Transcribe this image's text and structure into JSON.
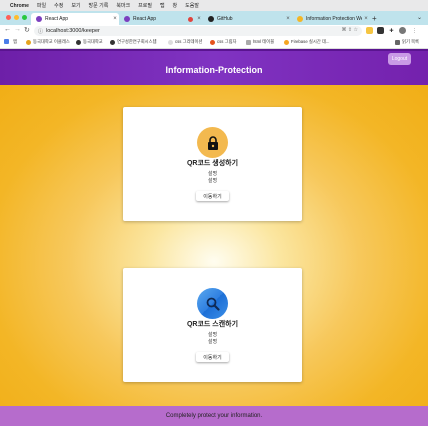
{
  "menubar": {
    "app": "Chrome",
    "items": [
      "파일",
      "수정",
      "보기",
      "방문 기록",
      "북마크",
      "프로필",
      "탭",
      "창",
      "도움말"
    ]
  },
  "tabs": [
    {
      "title": "React App",
      "active": true
    },
    {
      "title": "React App",
      "active": false
    },
    {
      "title": "GitHub",
      "active": false
    },
    {
      "title": "Information Protection Web",
      "active": false
    }
  ],
  "toolbar": {
    "url": "localhost:3000/keeper"
  },
  "bookmarks": {
    "apps_label": "앱",
    "items": [
      "동국대학교 이클래스",
      "동국대학교",
      "연구성한연구회시스템",
      "css 그라데이션",
      "css 그림자",
      "html 테이블",
      "Firebase 실시간 데..."
    ],
    "reading_list": "읽기 목록"
  },
  "app": {
    "title": "Information-Protection",
    "logout_label": "Logout",
    "cards": [
      {
        "title": "QR코드 생성하기",
        "desc1": "설명",
        "desc2": "설명",
        "button": "이동하기",
        "icon": "lock-icon"
      },
      {
        "title": "QR코드 스캔하기",
        "desc1": "설명",
        "desc2": "설명",
        "button": "이동하기",
        "icon": "magnifier-icon"
      }
    ],
    "footer": "Completely protect your information."
  },
  "colors": {
    "header": "#7a2bb8",
    "footer": "#b66ccc",
    "background": "#f3b626",
    "logout_button": "#c99ae6",
    "lock_circle": "#f3b94f",
    "scan_circle": "#2f7fe0"
  }
}
